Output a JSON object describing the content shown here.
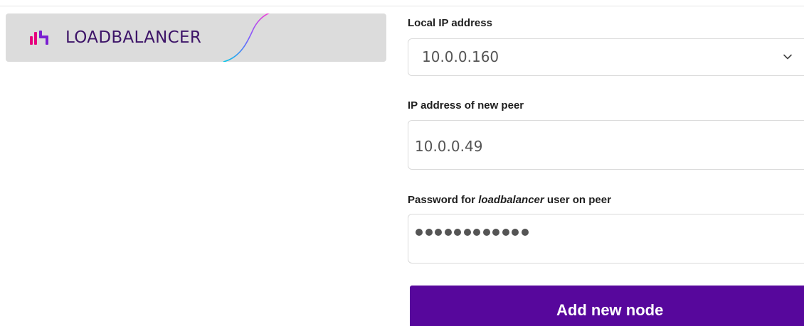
{
  "logo": {
    "text": "LOADBALANCER",
    "icon": "loadbalancer-logo-mark-icon",
    "colors": {
      "card": "#dcdcdc",
      "text": "#3d1468",
      "mark_pink": "#e6007e",
      "mark_purple": "#7a1fd1",
      "swoosh_start": "#00c8e6",
      "swoosh_end": "#ff3cd2"
    }
  },
  "form": {
    "local_ip": {
      "label": "Local IP address",
      "value": "10.0.0.160",
      "icon": "chevron-down-icon"
    },
    "peer_ip": {
      "label": "IP address of new peer",
      "value": "10.0.0.49"
    },
    "password": {
      "label_prefix": "Password for ",
      "label_em": "loadbalancer",
      "label_suffix": " user on peer",
      "masked_length": 12
    },
    "submit": {
      "label": "Add new node",
      "color": "#57079c"
    }
  }
}
